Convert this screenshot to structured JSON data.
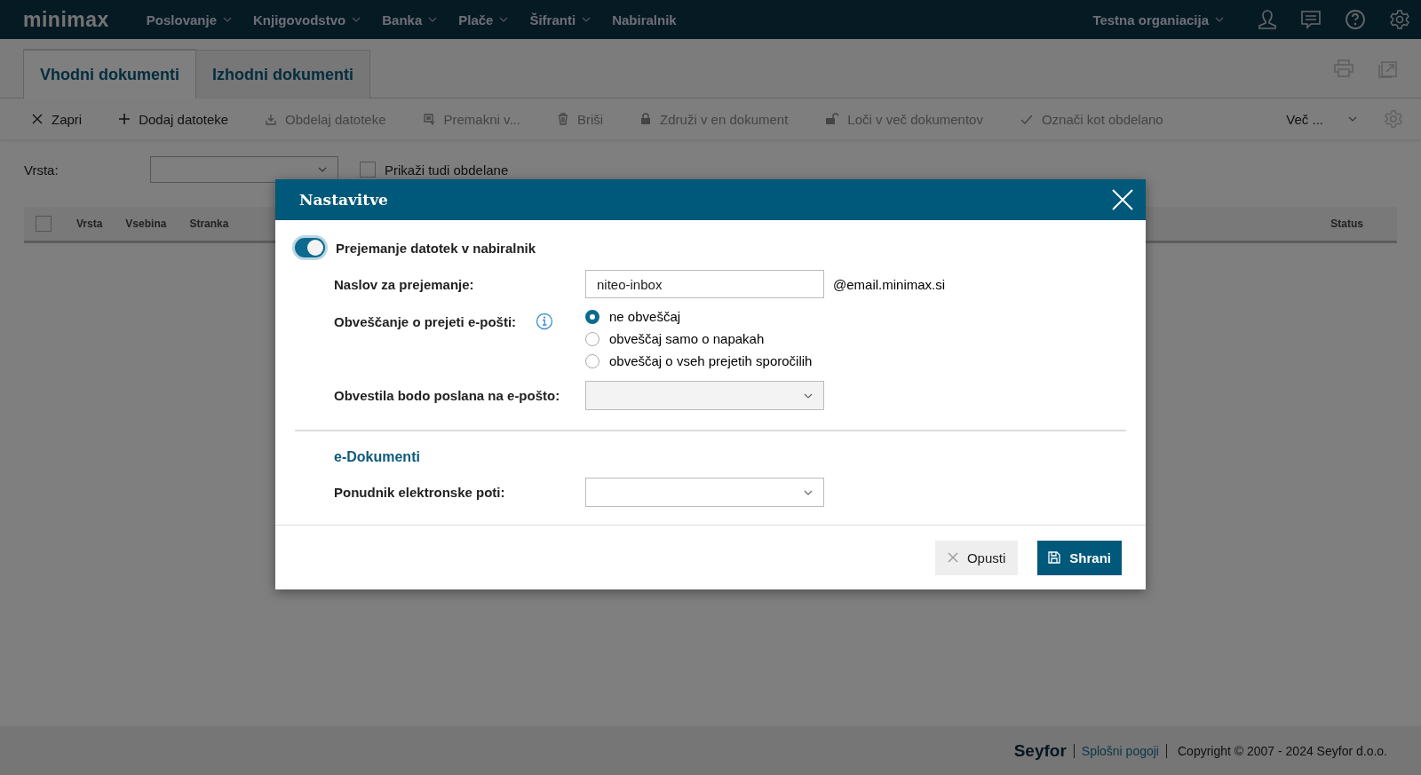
{
  "brand": "minimax",
  "nav": [
    {
      "label": "Poslovanje",
      "dropdown": true
    },
    {
      "label": "Knjigovodstvo",
      "dropdown": true
    },
    {
      "label": "Banka",
      "dropdown": true
    },
    {
      "label": "Plače",
      "dropdown": true
    },
    {
      "label": "Šifranti",
      "dropdown": true
    },
    {
      "label": "Nabiralnik",
      "dropdown": false
    }
  ],
  "organization": "Testna organiacija",
  "tabs": [
    {
      "label": "Vhodni dokumenti",
      "selected": true
    },
    {
      "label": "Izhodni dokumenti",
      "selected": false
    }
  ],
  "toolbar": [
    {
      "label": "Zapri",
      "kind": "close",
      "disabled": false
    },
    {
      "label": "Dodaj datoteke",
      "kind": "add",
      "disabled": false
    },
    {
      "label": "Obdelaj datoteke",
      "kind": "process",
      "disabled": true
    },
    {
      "label": "Premakni v...",
      "kind": "move",
      "disabled": true
    },
    {
      "label": "Briši",
      "kind": "delete",
      "disabled": true
    },
    {
      "label": "Združi v en dokument",
      "kind": "merge",
      "disabled": true
    },
    {
      "label": "Loči v več dokumentov",
      "kind": "split",
      "disabled": true
    },
    {
      "label": "Označi kot obdelano",
      "kind": "mark",
      "disabled": true
    }
  ],
  "more": "Več ...",
  "filter": {
    "label": "Vrsta:",
    "show_processed": {
      "label": "Prikaži tudi obdelane",
      "checked": false
    }
  },
  "table": {
    "select_all_checked": false,
    "columns": [
      "Vrsta",
      "Vsebina",
      "Stranka",
      "Status"
    ]
  },
  "dialog": {
    "title": "Nastavitve",
    "toggle": {
      "label": "Prejemanje datotek v nabiralnik",
      "on": true
    },
    "address": {
      "label": "Naslov za prejemanje:",
      "value": "niteo-inbox",
      "suffix": "@email.minimax.si"
    },
    "notify": {
      "label": "Obveščanje o prejeti e-pošti:",
      "options": [
        {
          "label": "ne obveščaj",
          "selected": true
        },
        {
          "label": "obveščaj samo o napakah",
          "selected": false
        },
        {
          "label": "obveščaj o vseh prejetih sporočilih",
          "selected": false
        }
      ]
    },
    "recipients": {
      "label": "Obvestila bodo poslana na e-pošto:",
      "disabled": true
    },
    "section": "e-Dokumenti",
    "provider": {
      "label": "Ponudnik elektronske poti:",
      "disabled": false
    },
    "cancel": "Opusti",
    "save": "Shrani"
  },
  "footer": {
    "brand": "Seyfor",
    "link": "Splošni pogoji",
    "copyright": "Copyright © 2007 - 2024 Seyfor d.o.o."
  }
}
